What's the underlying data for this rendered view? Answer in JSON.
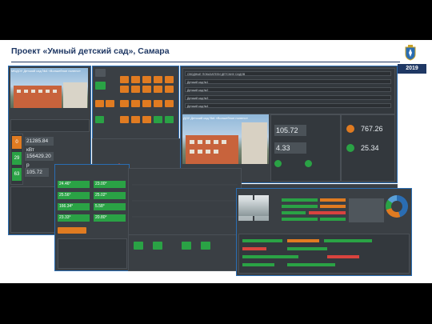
{
  "slide": {
    "title": "Проект «Умный детский сад», Самара",
    "year": "2019"
  },
  "screens": {
    "left_caption": "МБДОУ Детский сад №4 «Волшебное полено»",
    "center_caption": "ДОУ Детский сад №4 «Волшебное полено»",
    "left_values": [
      "21285.84 кВт",
      "156429.20 р",
      "105.72"
    ],
    "left_counts": [
      "0",
      "29",
      "63"
    ],
    "center_values": [
      "105.72",
      "4.33"
    ],
    "right_values": [
      "767.26",
      "25.34"
    ],
    "mid_values": [
      "24.46°",
      "25.56°",
      "166.34°",
      "23.33°",
      "23.00°",
      "25.02°",
      "5.58°",
      "20.80°"
    ],
    "list_rows": [
      "СВОДНЫЕ ПОКАЗАТЕЛИ ДЕТСКИХ САДОВ",
      "Детский сад №1",
      "Детский сад №2",
      "Детский сад №3",
      "Детский сад №4"
    ]
  },
  "colors": {
    "brand": "#1f3864",
    "accent": "#e07b21",
    "ok": "#2aa245",
    "frame": "#2a6db3"
  }
}
